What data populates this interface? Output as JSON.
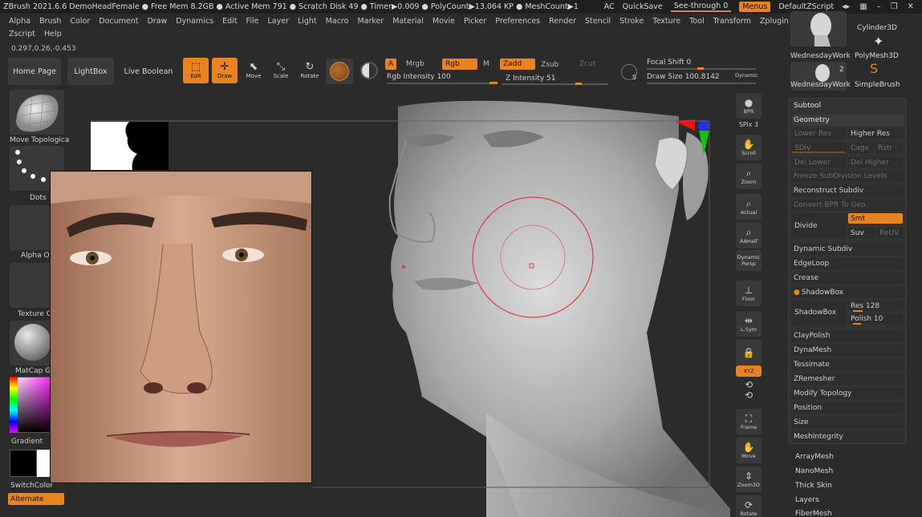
{
  "titlebar": {
    "status": "ZBrush 2021.6.6    DemoHeadFemale    ● Free Mem 8.2GB ● Active Mem 791 ● Scratch Disk 49 ● Timer▶0.009 ● PolyCount▶13.064 KP ● MeshCount▶1",
    "ac": "AC",
    "quicksave": "QuickSave",
    "see_through": "See-through  0",
    "menus": "Menus",
    "default_zscript": "DefaultZScript"
  },
  "menu": {
    "row1": [
      "Alpha",
      "Brush",
      "Color",
      "Document",
      "Draw",
      "Dynamics",
      "Edit",
      "File",
      "Layer",
      "Light",
      "Macro",
      "Marker",
      "Material",
      "Movie",
      "Picker",
      "Preferences",
      "Render",
      "Stencil",
      "Stroke",
      "Texture",
      "Tool",
      "Transform",
      "Zplugin"
    ],
    "row2": [
      "Zscript",
      "Help"
    ]
  },
  "coords": "0.297,0.26,-0.453",
  "toolbar": {
    "home_page": "Home Page",
    "lightbox": "LightBox",
    "live_boolean": "Live Boolean",
    "edit": "Edit",
    "draw": "Draw",
    "move": "Move",
    "scale": "Scale",
    "rotate": "Rotate",
    "a": "A",
    "mrgb": "Mrgb",
    "rgb": "Rgb",
    "m": "M",
    "rgb_intensity": "Rgb Intensity 100",
    "zadd": "Zadd",
    "zsub": "Zsub",
    "zcut": "Zcut",
    "z_intensity": "Z Intensity 51",
    "focal_shift": "Focal Shift 0",
    "draw_size": "Draw Size 100.8142",
    "dynamic": "Dynamic",
    "s": "S"
  },
  "left": {
    "move_topological": "Move Topologica",
    "dots": "Dots",
    "alpha": "Alpha O",
    "texture": "Texture O",
    "matcap": "MatCap G",
    "gradient": "Gradient",
    "switch_color": "SwitchColor",
    "alternate": "Alternate"
  },
  "rightstrip": {
    "bpr": "BPR",
    "spix": "SPix 3",
    "scroll": "Scroll",
    "zoom": "Zoom",
    "actual": "Actual",
    "aahalf": "AAHalf",
    "dynamic": "Dynamic",
    "persp": "Persp",
    "floor": "Floor",
    "lsym": "L.Sym",
    "xyz": "XYZ",
    "frame": "Frame",
    "move": "Move",
    "zoom3d": "Zoom3D",
    "rotate": "Rotate"
  },
  "tools": {
    "cylinder": "Cylinder3D",
    "polymesh": "PolyMesh3D",
    "simplebrush": "SimpleBrush",
    "wednesday1": "WednesdayWork",
    "wednesday2": "WednesdayWork",
    "count2": "2"
  },
  "panel": {
    "subtool": "Subtool",
    "geometry": "Geometry",
    "lower_res": "Lower Res",
    "higher_res": "Higher Res",
    "sdiv": "SDiv",
    "cage": "Cage",
    "rstr": "Rstr",
    "del_lower": "Del Lower",
    "del_higher": "Del Higher",
    "freeze": "Freeze SubDivision Levels",
    "reconstruct": "Reconstruct Subdiv",
    "convert_bpr": "Convert BPR To Geo",
    "divide": "Divide",
    "smt": "Smt",
    "suv": "Suv",
    "reuv": "ReUV",
    "dynamic_subdiv": "Dynamic Subdiv",
    "edgeloop": "EdgeLoop",
    "crease": "Crease",
    "shadowbox_header": "ShadowBox",
    "shadowbox": "ShadowBox",
    "res": "Res 128",
    "polish": "Polish 10",
    "claypolish": "ClayPolish",
    "dynamesh": "DynaMesh",
    "tessimate": "Tessimate",
    "zremesher": "ZRemesher",
    "modify_topology": "Modify Topology",
    "position": "Position",
    "size": "Size",
    "meshintegrity": "MeshIntegrity"
  },
  "below_panel": [
    "ArrayMesh",
    "NanoMesh",
    "Thick Skin",
    "Layers",
    "FiberMesh"
  ],
  "colors": {
    "accent": "#e8831f",
    "bg": "#2b2b2b",
    "panel": "#333333"
  }
}
